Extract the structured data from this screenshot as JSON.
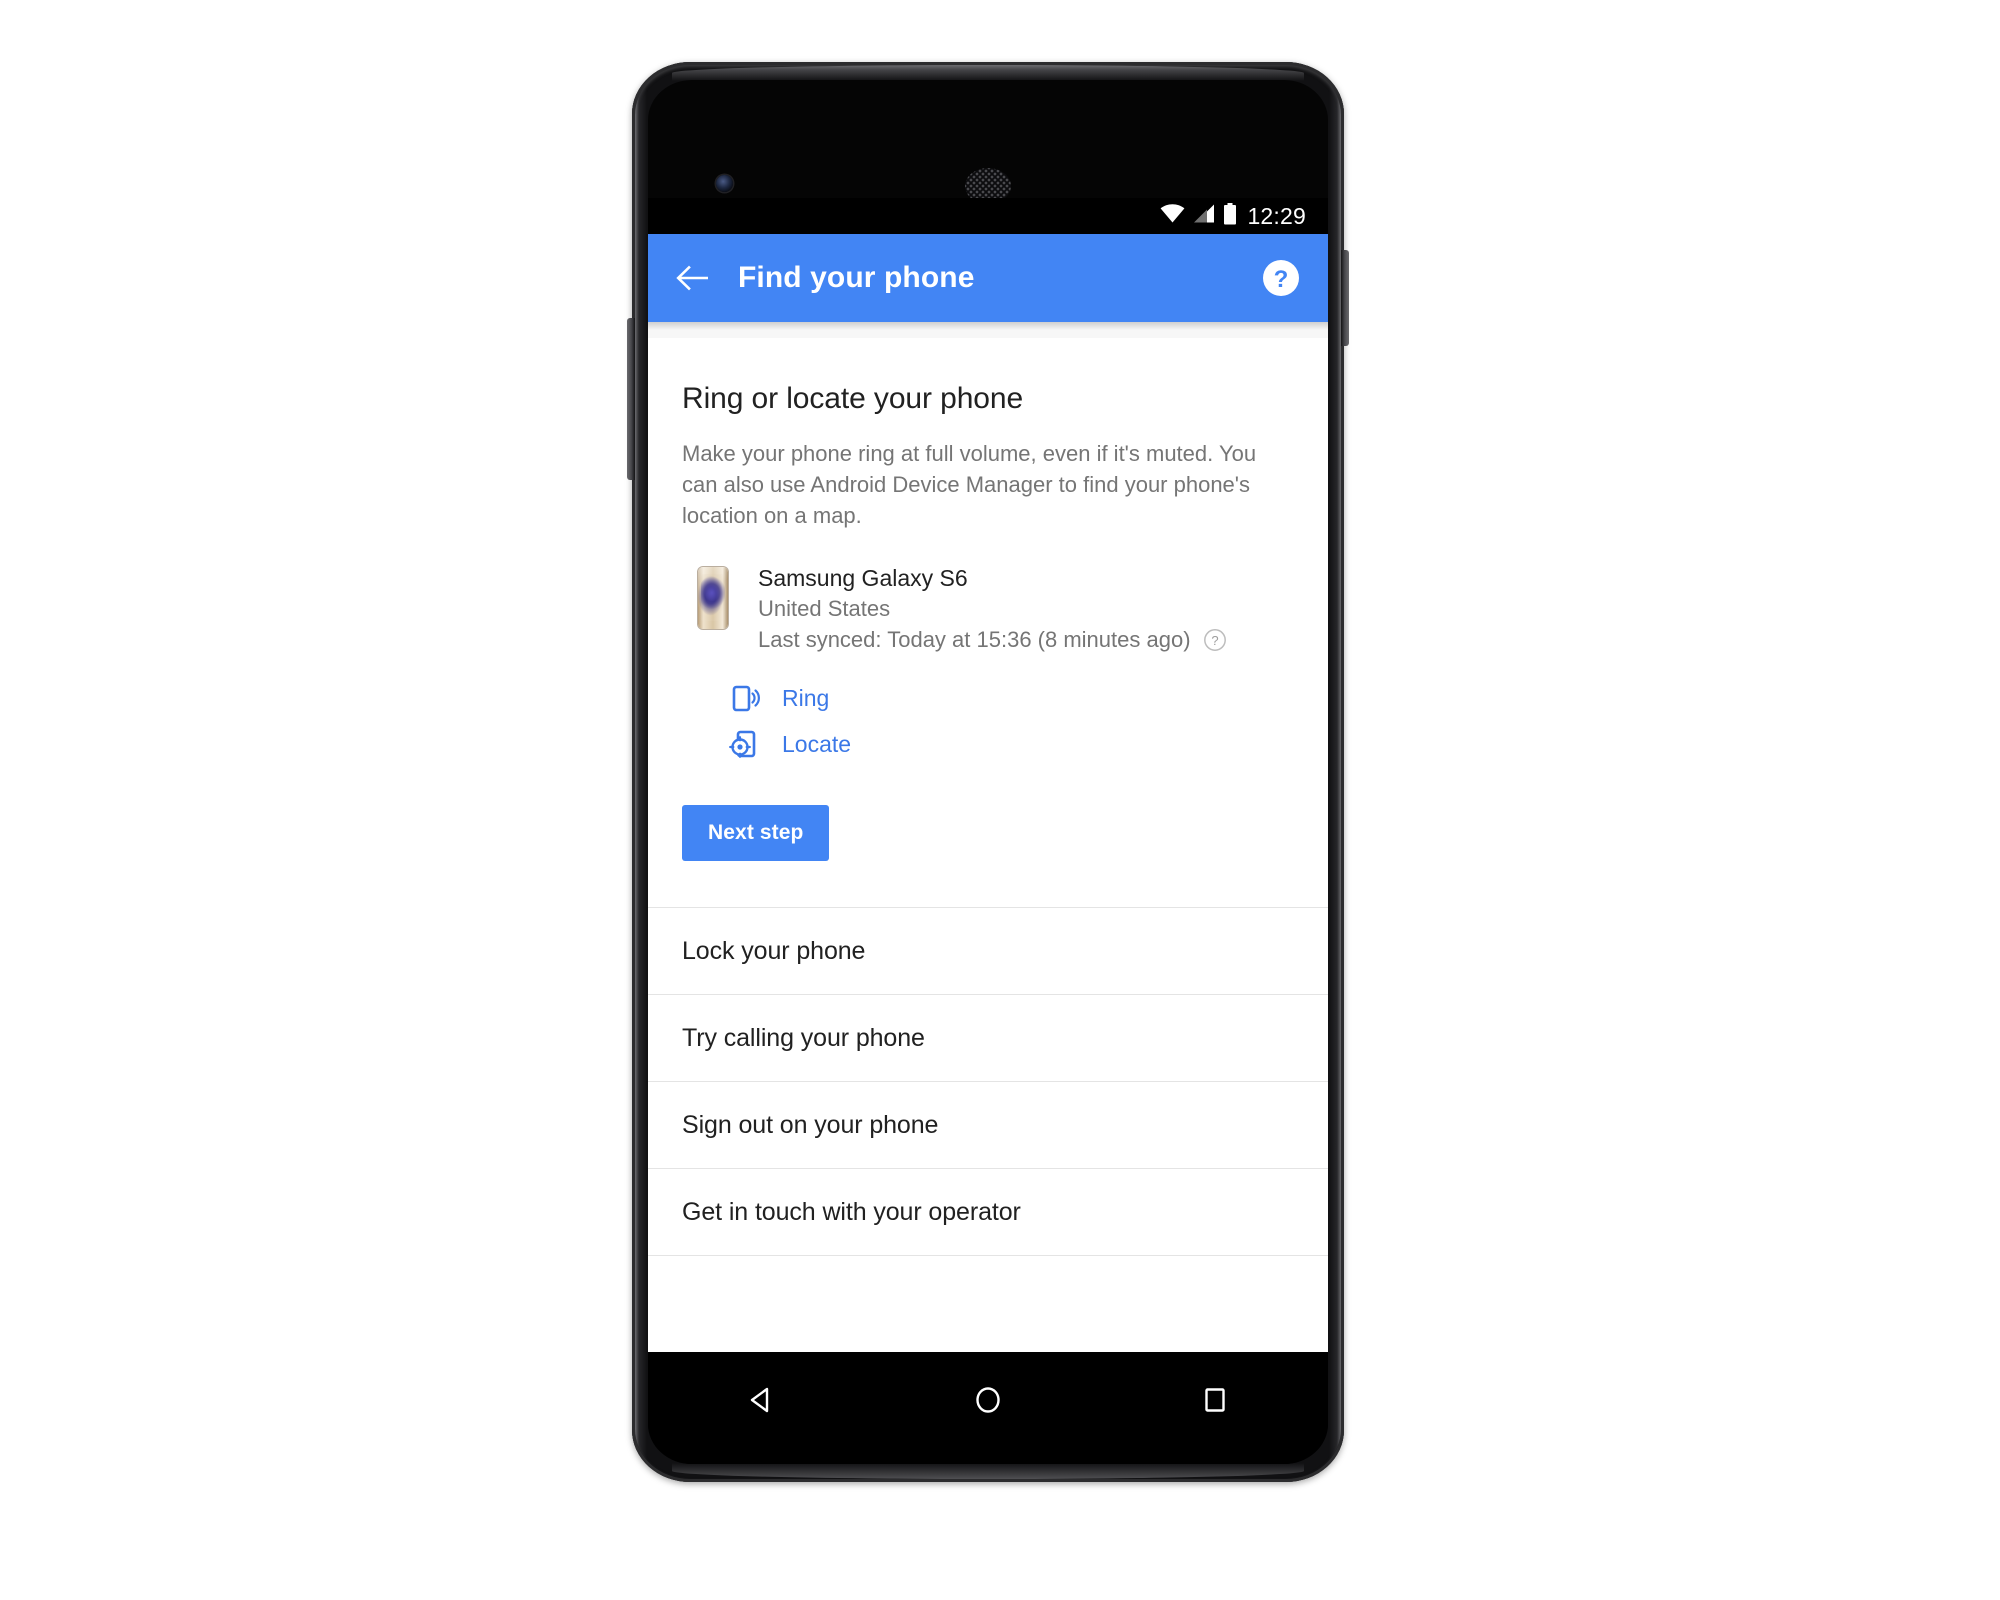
{
  "status_bar": {
    "time": "12:29",
    "icons": [
      "wifi-icon",
      "cellular-signal-icon",
      "battery-icon"
    ]
  },
  "app_bar": {
    "back_icon": "back-arrow-icon",
    "title": "Find your phone",
    "help_icon": "help-circle-icon",
    "background_color": "#4285f4"
  },
  "main": {
    "heading": "Ring or locate your phone",
    "description": "Make your phone ring at full volume, even if it's muted. You can also use Android Device Manager to find your phone's location on a map.",
    "device": {
      "thumbnail": "samsung-galaxy-s6-thumbnail",
      "name": "Samsung Galaxy S6",
      "country": "United States",
      "last_synced": "Last synced: Today at 15:36 (8 minutes ago)",
      "sync_help_icon": "help-circle-outline-icon"
    },
    "actions": [
      {
        "label": "Ring",
        "icon": "phone-ringing-icon"
      },
      {
        "label": "Locate",
        "icon": "phone-locate-target-icon"
      }
    ],
    "primary_button": {
      "label": "Next step",
      "color": "#4285f4"
    },
    "link_color": "#3b78e7"
  },
  "collapsed_sections": [
    {
      "label": "Lock your phone"
    },
    {
      "label": "Try calling your phone"
    },
    {
      "label": "Sign out on your phone"
    },
    {
      "label": "Get in touch with your operator"
    }
  ],
  "nav_bar": {
    "back_icon": "nav-back-triangle-icon",
    "home_icon": "nav-home-circle-icon",
    "recents_icon": "nav-recents-square-icon"
  },
  "hardware": {
    "front_camera": "front-camera",
    "earpiece": "earpiece-speaker",
    "volume_button": "volume-rocker-button",
    "power_button": "power-button"
  }
}
